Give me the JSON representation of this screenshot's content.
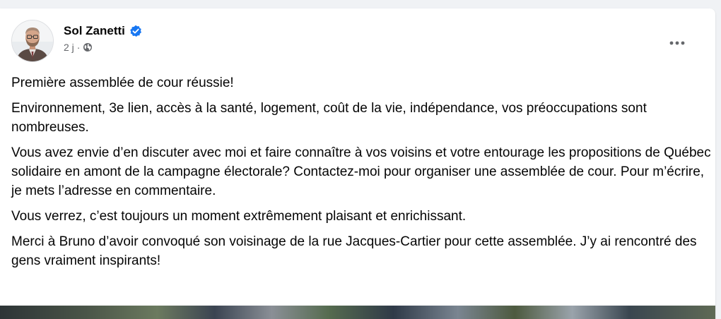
{
  "post": {
    "author": {
      "name": "Sol Zanetti",
      "avatar_icon": "profile-photo",
      "verified_icon": "verified-badge-icon"
    },
    "timestamp": "2 j",
    "separator": "·",
    "audience_icon": "globe-icon",
    "more_icon": "ellipsis-icon",
    "paragraphs": [
      "Première assemblée de cour réussie!",
      "Environnement, 3e lien, accès à la santé, logement, coût de la vie, indépendance, vos préoccupations sont nombreuses.",
      "Vous avez envie d’en discuter avec moi et faire connaître à vos voisins et votre entourage les propositions de Québec solidaire en amont de la campagne électorale? Contactez-moi pour organiser une assemblée de cour. Pour m’écrire, je mets l’adresse en commentaire.",
      "Vous verrez, c’est toujours un moment extrêmement plaisant et enrichissant.",
      "Merci à Bruno d’avoir convoqué son voisinage de la rue Jacques-Cartier pour cette assemblée. J’y ai rencontré des gens vraiment inspirants!"
    ]
  },
  "colors": {
    "accent": "#1877f2",
    "text_primary": "#050505",
    "text_secondary": "#65676b",
    "background": "#f0f2f5",
    "card": "#ffffff"
  }
}
